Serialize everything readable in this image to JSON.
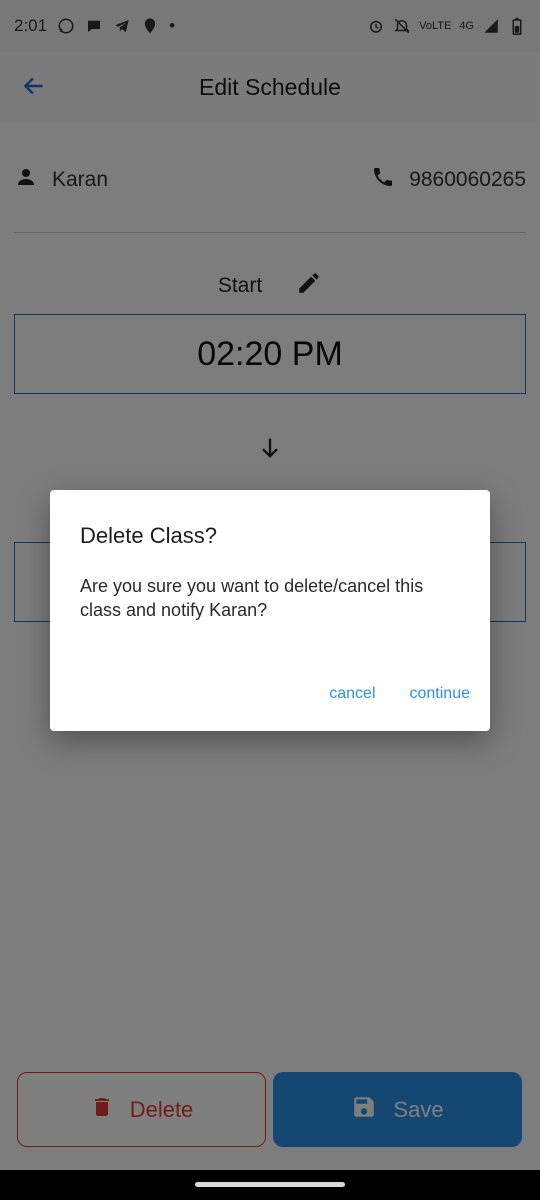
{
  "status_bar": {
    "time": "2:01",
    "dot": "•",
    "network": "4G",
    "volte": "VoLTE"
  },
  "app_bar": {
    "title": "Edit Schedule",
    "back_icon": "arrow-left-icon"
  },
  "contact": {
    "name": "Karan",
    "phone": "9860060265"
  },
  "schedule": {
    "start_label": "Start",
    "start_time": "02:20 PM",
    "end_time": ""
  },
  "buttons": {
    "delete_label": "Delete",
    "save_label": "Save"
  },
  "dialog": {
    "title": "Delete Class?",
    "message": "Are you sure you want to delete/cancel this class and notify Karan?",
    "cancel_label": "cancel",
    "continue_label": "continue"
  },
  "colors": {
    "accent": "#2b8fe6",
    "danger": "#e53935",
    "border_blue": "#1e6fc8"
  }
}
